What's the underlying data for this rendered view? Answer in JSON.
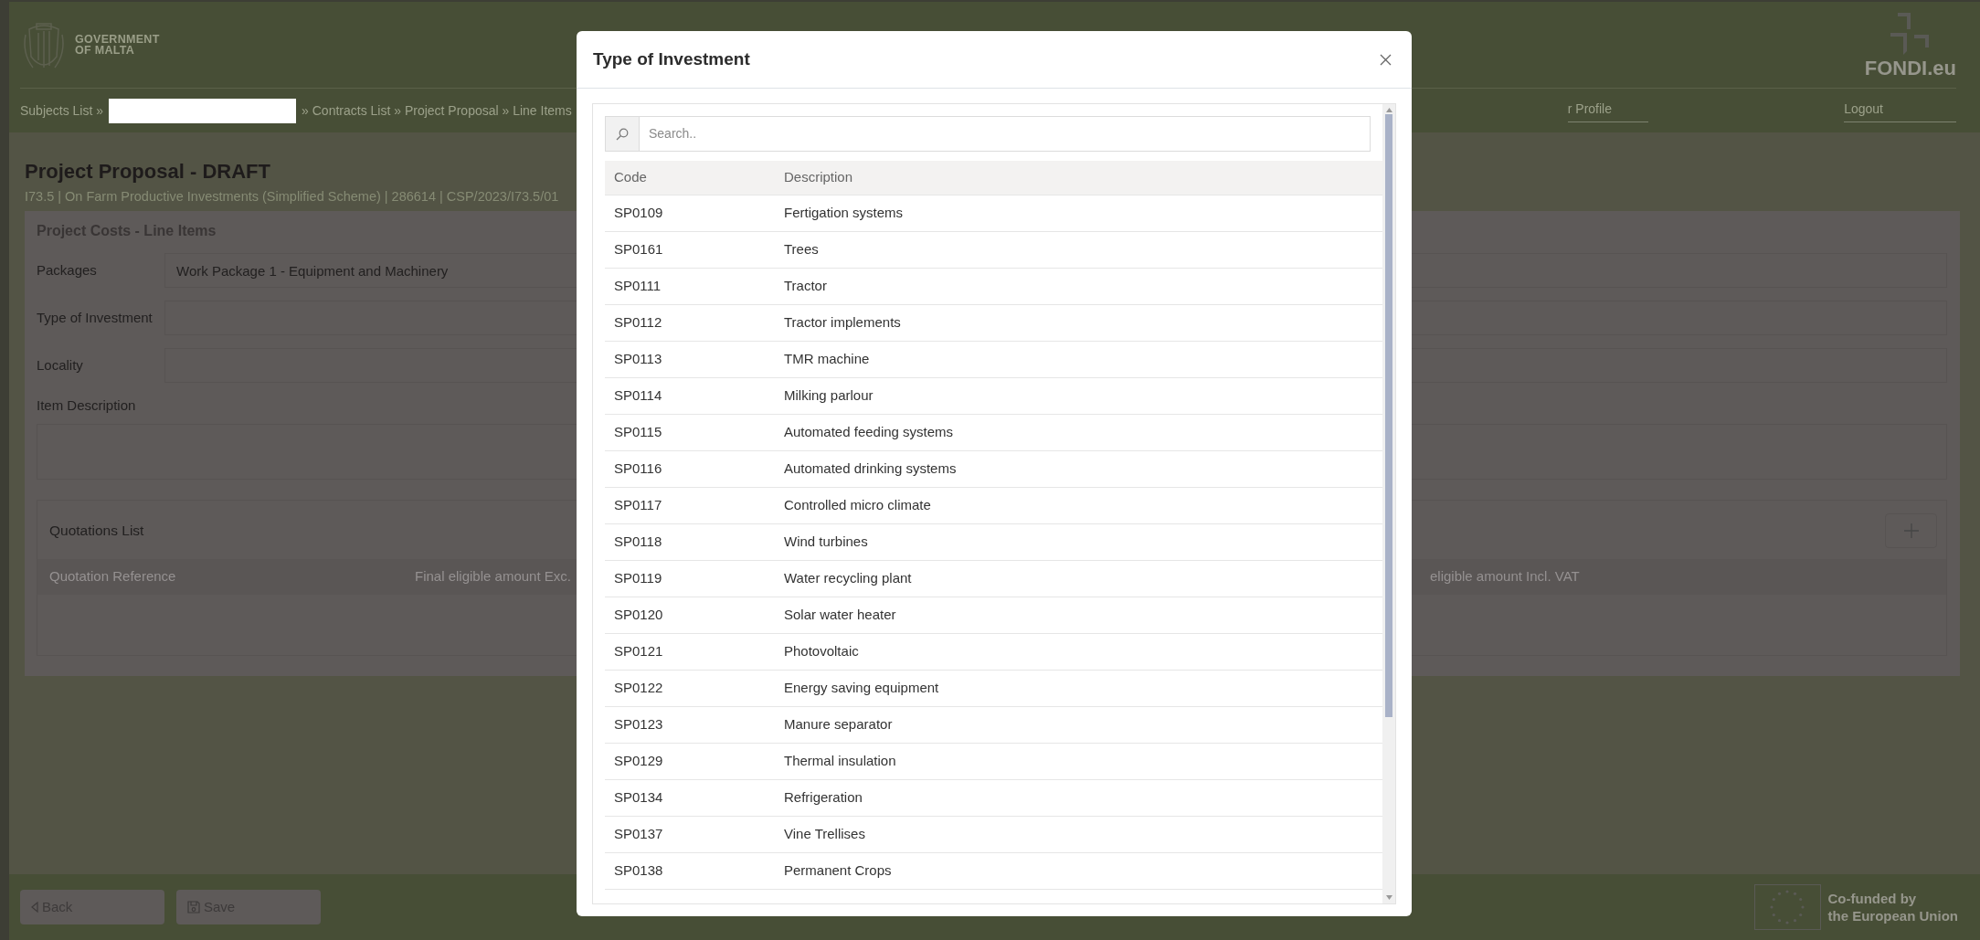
{
  "header": {
    "logo_lines": [
      "GOVERNMENT",
      "OF MALTA"
    ],
    "brand": "FONDI.eu"
  },
  "breadcrumb": {
    "before": "Subjects List »",
    "redacted": true,
    "after": "» Contracts List » Project Proposal » Line Items"
  },
  "nav_links": [
    {
      "label": "r Profile"
    },
    {
      "label": "Logout"
    }
  ],
  "page": {
    "title": "Project Proposal - DRAFT",
    "subtitle": "I73.5 | On Farm Productive Investments (Simplified Scheme) | 286614 | CSP/2023/I73.5/01"
  },
  "card": {
    "title": "Project Costs - Line Items",
    "fields": [
      {
        "kind": "input",
        "label": "Packages",
        "value": "Work Package 1 - Equipment and Machinery"
      },
      {
        "kind": "input",
        "label": "Type of Investment"
      },
      {
        "kind": "input",
        "label": "Locality"
      },
      {
        "kind": "textarea",
        "label": "Item Description"
      }
    ],
    "quotations": {
      "title": "Quotations List",
      "columns": [
        "Quotation Reference",
        "Final eligible amount Exc.",
        "eligible amount Incl. VAT"
      ]
    }
  },
  "footer": {
    "buttons": [
      {
        "kind": "back",
        "label": "Back"
      },
      {
        "kind": "save",
        "label": "Save"
      }
    ],
    "eu_lines": [
      "Co-funded by",
      "the European Union"
    ]
  },
  "modal": {
    "title": "Type of Investment",
    "search": {
      "placeholder": "Search.."
    },
    "columns": [
      "Code",
      "Description"
    ],
    "rows": [
      {
        "code": "SP0109",
        "description": "Fertigation systems"
      },
      {
        "code": "SP0161",
        "description": "Trees"
      },
      {
        "code": "SP0111",
        "description": "Tractor"
      },
      {
        "code": "SP0112",
        "description": "Tractor implements"
      },
      {
        "code": "SP0113",
        "description": "TMR machine"
      },
      {
        "code": "SP0114",
        "description": "Milking parlour"
      },
      {
        "code": "SP0115",
        "description": "Automated feeding systems"
      },
      {
        "code": "SP0116",
        "description": "Automated drinking systems"
      },
      {
        "code": "SP0117",
        "description": "Controlled micro climate"
      },
      {
        "code": "SP0118",
        "description": "Wind turbines"
      },
      {
        "code": "SP0119",
        "description": "Water recycling plant"
      },
      {
        "code": "SP0120",
        "description": "Solar water heater"
      },
      {
        "code": "SP0121",
        "description": "Photovoltaic"
      },
      {
        "code": "SP0122",
        "description": "Energy saving equipment"
      },
      {
        "code": "SP0123",
        "description": "Manure separator"
      },
      {
        "code": "SP0129",
        "description": "Thermal insulation"
      },
      {
        "code": "SP0134",
        "description": "Refrigeration"
      },
      {
        "code": "SP0137",
        "description": "Vine Trellises"
      },
      {
        "code": "SP0138",
        "description": "Permanent Crops"
      }
    ]
  }
}
